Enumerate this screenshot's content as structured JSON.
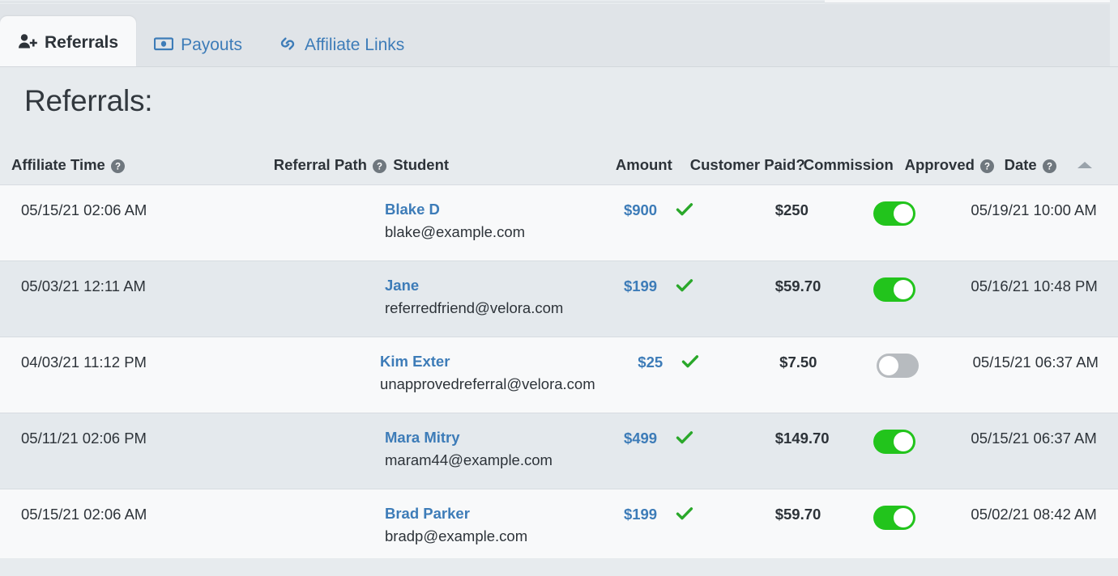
{
  "tabs": [
    {
      "label": "Referrals",
      "icon": "user-plus-icon",
      "active": true
    },
    {
      "label": "Payouts",
      "icon": "banknote-icon",
      "active": false
    },
    {
      "label": "Affiliate Links",
      "icon": "link-icon",
      "active": false
    }
  ],
  "page": {
    "title": "Referrals:"
  },
  "table": {
    "sort_indicator": "sort-ascending-caret",
    "columns": [
      {
        "key": "affiliate_time",
        "label": "Affiliate Time",
        "help": true
      },
      {
        "key": "referral_path",
        "label": "Referral Path",
        "help": true
      },
      {
        "key": "student",
        "label": "Student",
        "help": false
      },
      {
        "key": "amount",
        "label": "Amount",
        "help": false
      },
      {
        "key": "customer_paid",
        "label": "Customer Paid?",
        "help": false
      },
      {
        "key": "commission",
        "label": "Commission",
        "help": false
      },
      {
        "key": "approved",
        "label": "Approved",
        "help": true
      },
      {
        "key": "date",
        "label": "Date",
        "help": true
      }
    ],
    "rows": [
      {
        "affiliate_time": "05/15/21 02:06 AM",
        "referral_path": "",
        "student_name": "Blake D",
        "student_email": "blake@example.com",
        "amount": "$900",
        "customer_paid": true,
        "commission": "$250",
        "approved": true,
        "date": "05/19/21 10:00 AM"
      },
      {
        "affiliate_time": "05/03/21 12:11 AM",
        "referral_path": "",
        "student_name": "Jane",
        "student_email": "referredfriend@velora.com",
        "amount": "$199",
        "customer_paid": true,
        "commission": "$59.70",
        "approved": true,
        "date": "05/16/21 10:48 PM"
      },
      {
        "affiliate_time": "04/03/21 11:12 PM",
        "referral_path": "",
        "student_name": "Kim Exter",
        "student_email": "unapprovedreferral@velora.com",
        "amount": "$25",
        "customer_paid": true,
        "commission": "$7.50",
        "approved": false,
        "date": "05/15/21 06:37 AM"
      },
      {
        "affiliate_time": "05/11/21 02:06 PM",
        "referral_path": "",
        "student_name": "Mara Mitry",
        "student_email": "maram44@example.com",
        "amount": "$499",
        "customer_paid": true,
        "commission": "$149.70",
        "approved": true,
        "date": "05/15/21 06:37 AM"
      },
      {
        "affiliate_time": "05/15/21 02:06 AM",
        "referral_path": "",
        "student_name": "Brad Parker",
        "student_email": "bradp@example.com",
        "amount": "$199",
        "customer_paid": true,
        "commission": "$59.70",
        "approved": true,
        "date": "05/02/21 08:42 AM"
      }
    ]
  },
  "colors": {
    "link": "#3d7cb8",
    "toggle_on": "#22c41c",
    "toggle_off": "#b7bbbf",
    "check": "#2aa82a",
    "text": "#2d3339",
    "row_odd": "#f8f9fa",
    "row_even": "#e4e9ed",
    "page_bg": "#e7ebee"
  }
}
